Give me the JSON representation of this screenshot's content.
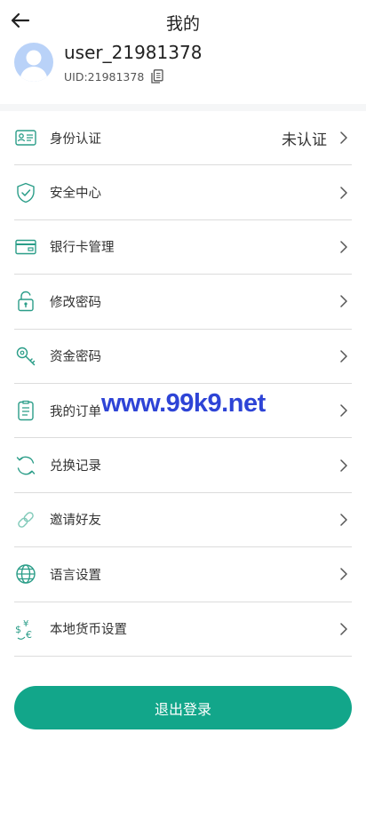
{
  "header": {
    "title": "我的"
  },
  "profile": {
    "username": "user_21981378",
    "uid": "UID:21981378"
  },
  "menu": [
    {
      "label": "身份认证",
      "value": "未认证",
      "icon": "id-card-icon"
    },
    {
      "label": "安全中心",
      "icon": "shield-check-icon"
    },
    {
      "label": "银行卡管理",
      "icon": "bank-card-icon"
    },
    {
      "label": "修改密码",
      "icon": "lock-icon"
    },
    {
      "label": "资金密码",
      "icon": "key-icon"
    },
    {
      "label": "我的订单",
      "icon": "order-list-icon"
    },
    {
      "label": "兑换记录",
      "icon": "refresh-icon"
    },
    {
      "label": "邀请好友",
      "icon": "link-icon"
    },
    {
      "label": "语言设置",
      "icon": "globe-icon"
    },
    {
      "label": "本地货币设置",
      "icon": "currency-exchange-icon"
    }
  ],
  "watermark": "www.99k9.net",
  "logout": {
    "label": "退出登录"
  },
  "colors": {
    "accent": "#12a68a",
    "icon_green": "#2a9d88",
    "watermark": "#2e44d6"
  }
}
